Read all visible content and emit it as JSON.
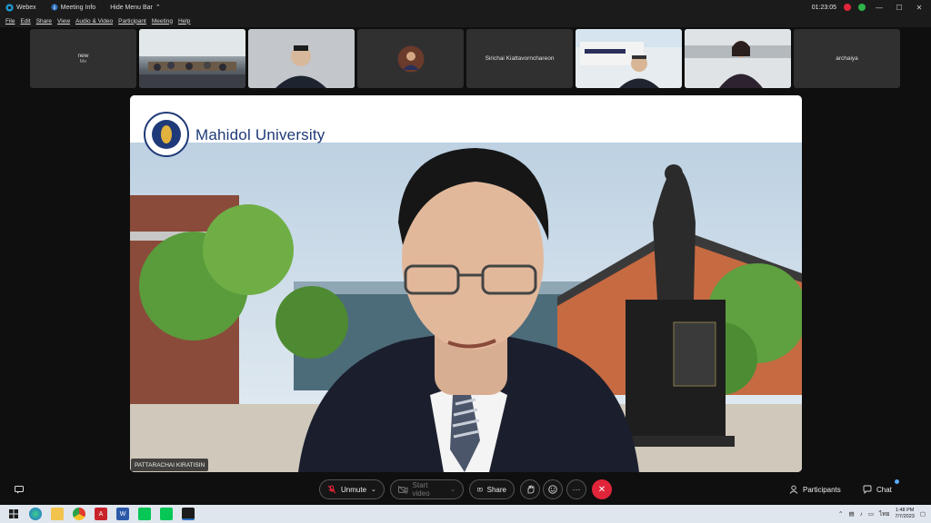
{
  "titlebar": {
    "app_name": "Webex",
    "meeting_info": "Meeting Info",
    "hide_menu_bar": "Hide Menu Bar",
    "timer": "01:23:05"
  },
  "menu": [
    "File",
    "Edit",
    "Share",
    "View",
    "Audio & Video",
    "Participant",
    "Meeting",
    "Help"
  ],
  "participants_strip": [
    {
      "name": "new",
      "sub": "Me"
    },
    {
      "name": "",
      "sub": ""
    },
    {
      "name": "",
      "sub": ""
    },
    {
      "name": "",
      "sub": ""
    },
    {
      "name": "Sirichai Kiattavornchareon",
      "sub": ""
    },
    {
      "name": "",
      "sub": ""
    },
    {
      "name": "",
      "sub": ""
    },
    {
      "name": "archaiya",
      "sub": ""
    }
  ],
  "main_video": {
    "logo_text": "Mahidol University",
    "speaker_name": "PATTARACHAI KIRATISIN"
  },
  "controls": {
    "unmute": "Unmute",
    "start_video": "Start video",
    "share": "Share",
    "more": "···",
    "end": "✕",
    "participants": "Participants",
    "chat": "Chat"
  },
  "taskbar": {
    "language": "ไทย",
    "time": "1:48 PM",
    "date": "7/7/2023"
  },
  "colors": {
    "end_red": "#e0253a",
    "accent_blue": "#2a6ebb"
  }
}
